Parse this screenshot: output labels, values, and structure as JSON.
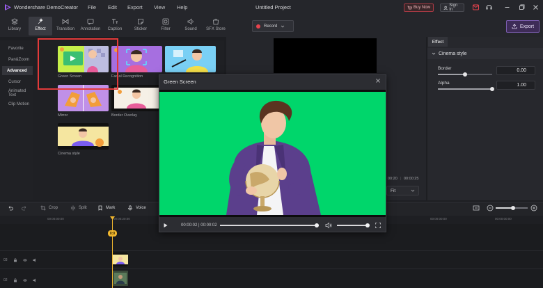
{
  "app": {
    "name": "Wondershare DemoCreator",
    "project_title": "Untitled Project"
  },
  "menu": [
    "File",
    "Edit",
    "Export",
    "View",
    "Help"
  ],
  "titlebar_buttons": {
    "buy_now": "Buy Now",
    "sign_in": "Sign In"
  },
  "toolbar": {
    "tools": [
      {
        "label": "Library",
        "icon": "library-icon"
      },
      {
        "label": "Effect",
        "icon": "effect-icon",
        "active": true
      },
      {
        "label": "Transition",
        "icon": "transition-icon"
      },
      {
        "label": "Annotation",
        "icon": "annotation-icon"
      },
      {
        "label": "Caption",
        "icon": "caption-icon"
      },
      {
        "label": "Sticker",
        "icon": "sticker-icon"
      },
      {
        "label": "Filter",
        "icon": "filter-icon"
      },
      {
        "label": "Sound",
        "icon": "sound-icon"
      },
      {
        "label": "SFX Store",
        "icon": "sfx-store-icon"
      }
    ],
    "record_label": "Record",
    "export_label": "Export"
  },
  "categories": [
    {
      "label": "Favorite"
    },
    {
      "label": "Pan&Zoom"
    },
    {
      "label": "Advanced",
      "active": true
    },
    {
      "label": "Cursor"
    },
    {
      "label": "Animated Text"
    },
    {
      "label": "Clip Motion"
    }
  ],
  "effects": [
    {
      "label": "Green Screen"
    },
    {
      "label": "Facial Recognition"
    },
    {
      "label": ""
    },
    {
      "label": "Mirror"
    },
    {
      "label": "Border Overlay"
    },
    {
      "label": "Cinema style"
    }
  ],
  "properties": {
    "tab": "Effect",
    "section": "Cinema style",
    "border": {
      "label": "Border",
      "value": "0.00",
      "level": 0.5
    },
    "alpha": {
      "label": "Alpha",
      "value": "1.00",
      "level": 1.0
    }
  },
  "preview": {
    "time_left": "00:20",
    "time_total": "00:00:25",
    "fit": "Fit"
  },
  "popup": {
    "title": "Green Screen",
    "time": "00:00:02 | 00:00:02",
    "progress": 0.98,
    "volume": 1.0,
    "bg_color": "#00d66b"
  },
  "timeline": {
    "tools": [
      "Crop",
      "Split",
      "Mark",
      "Voice"
    ],
    "ticks": [
      "00:00:00:00",
      "00:00:20:00",
      "00:00:20:00",
      "00:00:20:00"
    ],
    "ticks_right": [
      "00:00:00:00",
      "00:00:00:00",
      "00:00:00:00"
    ],
    "playhead_label": "0:0",
    "track_numbers": [
      "03",
      "02"
    ]
  },
  "colors": {
    "accent": "#7a5cae",
    "highlight": "#e33a3a",
    "playhead": "#f0b62e"
  }
}
